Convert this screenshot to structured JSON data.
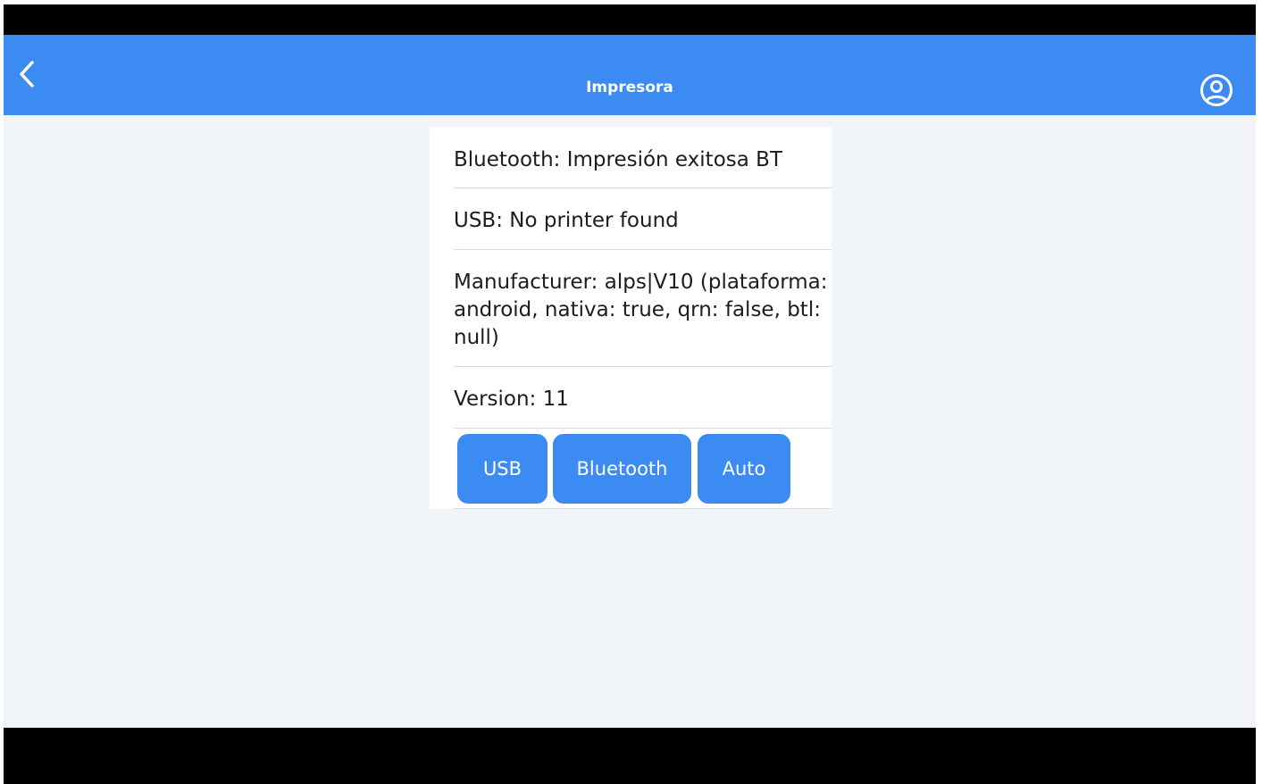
{
  "header": {
    "title": "Impresora",
    "back_icon": "chevron-left-icon",
    "profile_icon": "user-circle-icon"
  },
  "printer_info": {
    "bluetooth": "Bluetooth: Impresión exitosa BT",
    "usb": "USB: No printer found",
    "manufacturer": "Manufacturer: alps|V10 (plataforma: android, nativa: true, qrn: false, btl: null)",
    "version": "Version: 11"
  },
  "actions": {
    "usb_label": "USB",
    "bluetooth_label": "Bluetooth",
    "auto_label": "Auto"
  },
  "colors": {
    "accent": "#3b8bf3",
    "background": "#f1f4f8",
    "card": "#ffffff",
    "system_bars": "#000000"
  }
}
